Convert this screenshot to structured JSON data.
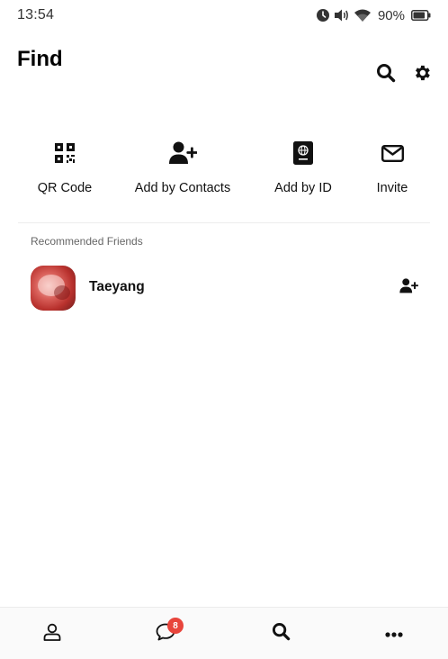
{
  "status_bar": {
    "time": "13:54",
    "battery_percent": "90%",
    "battery_level": 0.9,
    "icons": [
      "alarm-icon",
      "volume-icon",
      "wifi-icon",
      "battery-icon"
    ]
  },
  "header": {
    "title": "Find",
    "icons": [
      "search-icon",
      "settings-gear-icon"
    ]
  },
  "actions": [
    {
      "label": "QR Code",
      "icon": "qr-code-icon"
    },
    {
      "label": "Add by Contacts",
      "icon": "add-user-icon"
    },
    {
      "label": "Add by ID",
      "icon": "id-book-icon"
    },
    {
      "label": "Invite",
      "icon": "envelope-icon"
    }
  ],
  "recommended": {
    "section_label": "Recommended Friends",
    "friends": [
      {
        "name": "Taeyang",
        "action_icon": "add-user-icon"
      }
    ]
  },
  "bottom_nav": {
    "items": [
      {
        "id": "friends",
        "icon": "person-icon"
      },
      {
        "id": "chats",
        "icon": "chat-bubble-icon",
        "badge": "8"
      },
      {
        "id": "find",
        "icon": "search-icon",
        "active": true
      },
      {
        "id": "more",
        "icon": "more-dots-icon"
      }
    ]
  },
  "colors": {
    "badge": "#e8453c",
    "text": "#111111",
    "divider": "#ececec",
    "nav_background": "#fafafa"
  }
}
